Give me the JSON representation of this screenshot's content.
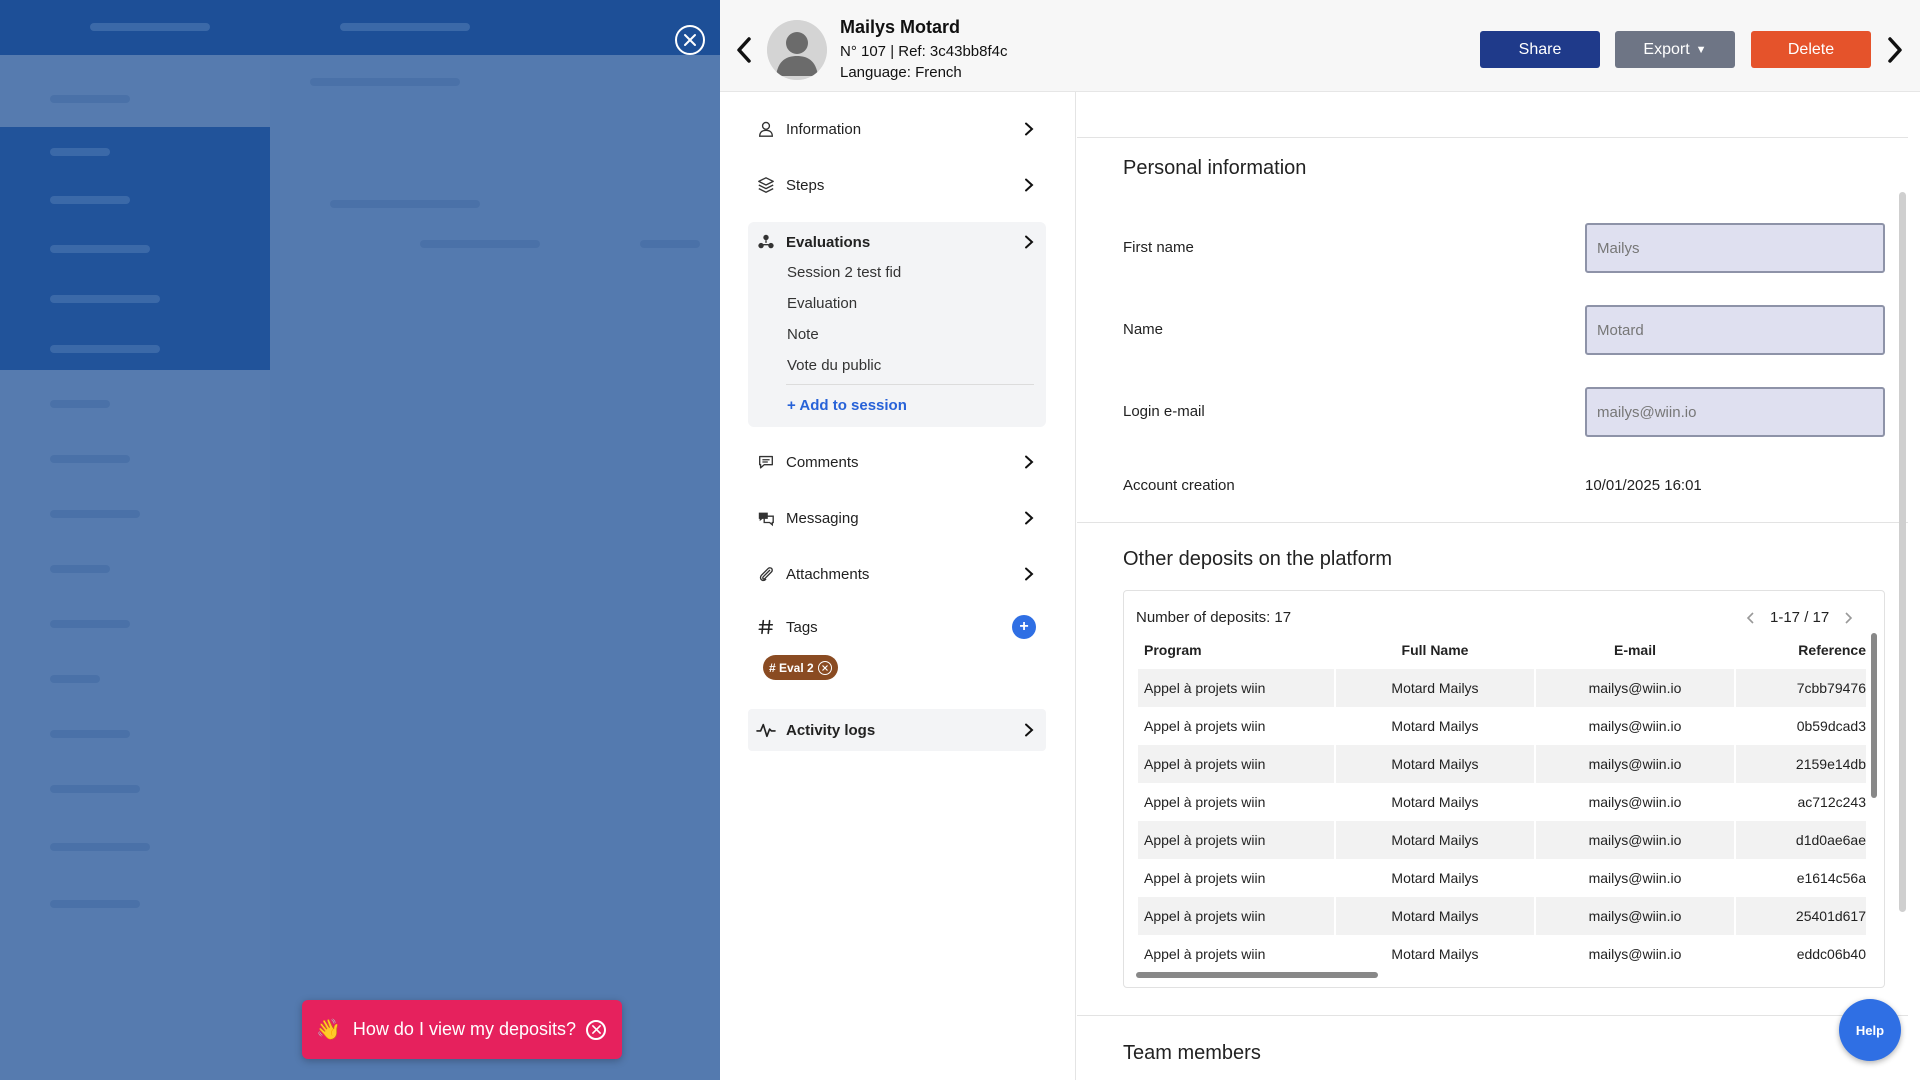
{
  "header": {
    "name": "Mailys Motard",
    "ref_line": "N° 107 | Ref: 3c43bb8f4c",
    "language_line": "Language: French",
    "share_label": "Share",
    "export_label": "Export",
    "delete_label": "Delete"
  },
  "nav": {
    "information": "Information",
    "steps": "Steps",
    "evaluations": "Evaluations",
    "evaluation_items": [
      "Session 2 test fid",
      "Evaluation",
      "Note",
      "Vote du public"
    ],
    "add_to_session": "+ Add to session",
    "comments": "Comments",
    "messaging": "Messaging",
    "attachments": "Attachments",
    "tags": "Tags",
    "tag_chip": "# Eval 2",
    "activity_logs": "Activity logs"
  },
  "personal": {
    "title": "Personal information",
    "first_name_label": "First name",
    "first_name_placeholder": "Mailys",
    "name_label": "Name",
    "name_placeholder": "Motard",
    "email_label": "Login e-mail",
    "email_placeholder": "mailys@wiin.io",
    "account_creation_label": "Account creation",
    "account_creation_value": "10/01/2025 16:01"
  },
  "deposits": {
    "title": "Other deposits on the platform",
    "count_text": "Number of deposits: 17",
    "pager_text": "1-17 / 17",
    "columns": [
      "Program",
      "Full Name",
      "E-mail",
      "Reference"
    ],
    "rows": [
      [
        "Appel à projets wiin",
        "Motard Mailys",
        "mailys@wiin.io",
        "7cbb79476"
      ],
      [
        "Appel à projets wiin",
        "Motard Mailys",
        "mailys@wiin.io",
        "0b59dcad3"
      ],
      [
        "Appel à projets wiin",
        "Motard Mailys",
        "mailys@wiin.io",
        "2159e14db"
      ],
      [
        "Appel à projets wiin",
        "Motard Mailys",
        "mailys@wiin.io",
        "ac712c243"
      ],
      [
        "Appel à projets wiin",
        "Motard Mailys",
        "mailys@wiin.io",
        "d1d0ae6ae"
      ],
      [
        "Appel à projets wiin",
        "Motard Mailys",
        "mailys@wiin.io",
        "e1614c56a"
      ],
      [
        "Appel à projets wiin",
        "Motard Mailys",
        "mailys@wiin.io",
        "25401d617"
      ],
      [
        "Appel à projets wiin",
        "Motard Mailys",
        "mailys@wiin.io",
        "eddc06b40"
      ]
    ]
  },
  "team": {
    "title": "Team members"
  },
  "toast": {
    "text": "How do I view my deposits?",
    "emoji": "👋"
  },
  "help_label": "Help",
  "colors": {
    "primary": "#1f3a8a",
    "danger": "#e5532b",
    "accent": "#2f6fe4",
    "toast": "#e6215d",
    "tag": "#8a4b22"
  }
}
